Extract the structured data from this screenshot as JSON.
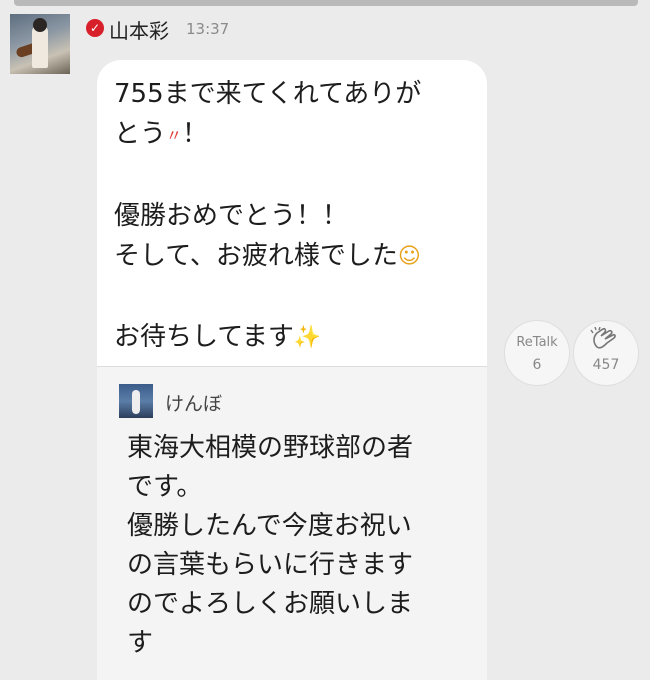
{
  "post": {
    "username": "山本彩",
    "time": "13:37",
    "verified_icon": "check-badge-icon",
    "message_parts": {
      "line1": "755まで来てくれてありが\nとう",
      "emoji1": "〃",
      "after1": "！\n\n優勝おめでとう！！\nそして、お疲れ様でした",
      "emoji2": "☺",
      "after2": "\n\nお待ちしてます",
      "emoji3": "✨"
    }
  },
  "quote": {
    "username": "けんぼ",
    "text": "東海大相模の野球部の者\nです。\n優勝したんで今度お祝い\nの言葉もらいに行きます\nのでよろしくお願いしま\nす"
  },
  "actions": {
    "retalk_label": "ReTalk",
    "retalk_count": "6",
    "clap_icon": "clapping-hands-icon",
    "clap_count": "457"
  }
}
